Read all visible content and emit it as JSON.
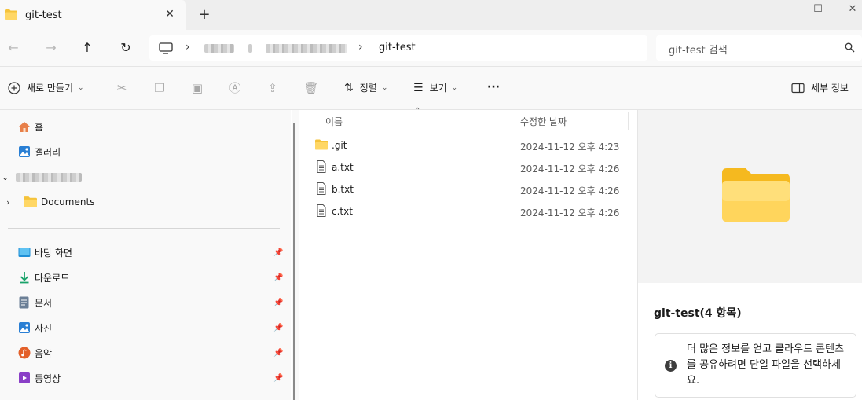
{
  "tab": {
    "title": "git-test",
    "close": "✕",
    "new": "+"
  },
  "window": {
    "minimize": "—",
    "maximize": "☐",
    "close": "✕"
  },
  "nav": {
    "back": "←",
    "forward": "→",
    "up": "↑",
    "refresh": "↻",
    "sep": "›"
  },
  "address": {
    "current": "git-test"
  },
  "search": {
    "placeholder": "git-test 검색"
  },
  "toolbar": {
    "new_label": "새로 만들기",
    "sort_label": "정렬",
    "view_label": "보기",
    "more_label": "···",
    "details_label": "세부 정보",
    "chevron": "⌄"
  },
  "sidebar": {
    "quick": [
      {
        "label": "홈",
        "icon": "home-icon"
      },
      {
        "label": "갤러리",
        "icon": "gallery-icon"
      }
    ],
    "documents_label": "Documents",
    "pinned": [
      {
        "label": "바탕 화면",
        "icon": "desktop-icon"
      },
      {
        "label": "다운로드",
        "icon": "download-icon"
      },
      {
        "label": "문서",
        "icon": "document-icon"
      },
      {
        "label": "사진",
        "icon": "pictures-icon"
      },
      {
        "label": "음악",
        "icon": "music-icon"
      },
      {
        "label": "동영상",
        "icon": "video-icon"
      }
    ]
  },
  "columns": {
    "name": "이름",
    "modified": "수정한 날짜"
  },
  "files": [
    {
      "name": ".git",
      "date": "2024-11-12 오후 4:23",
      "type": "folder"
    },
    {
      "name": "a.txt",
      "date": "2024-11-12 오후 4:26",
      "type": "text"
    },
    {
      "name": "b.txt",
      "date": "2024-11-12 오후 4:26",
      "type": "text"
    },
    {
      "name": "c.txt",
      "date": "2024-11-12 오후 4:26",
      "type": "text"
    }
  ],
  "details": {
    "title": "git-test(4 항목)",
    "info": "더 많은 정보를 얻고 클라우드 콘텐츠를 공유하려면 단일 파일을 선택하세요."
  },
  "colors": {
    "folder": "#f5c33b",
    "accent": "#0067c0"
  }
}
